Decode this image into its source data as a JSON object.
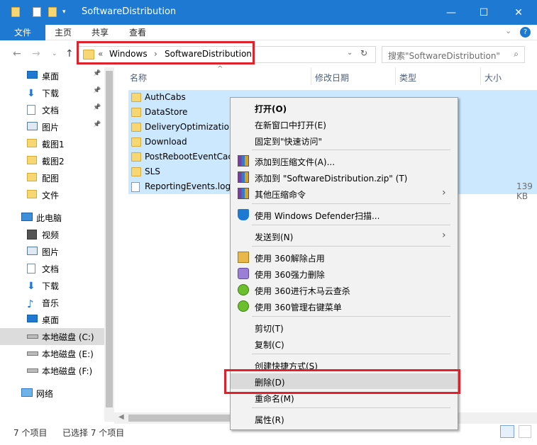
{
  "window": {
    "title": "SoftwareDistribution",
    "minimize": "—",
    "maximize": "☐",
    "close": "✕"
  },
  "ribbon": {
    "file": "文件",
    "tabs": [
      "主页",
      "共享",
      "查看"
    ]
  },
  "address": {
    "crumb_prefix": "«",
    "crumbs": [
      "Windows",
      "SoftwareDistribution"
    ],
    "search_placeholder": "搜索\"SoftwareDistribution\""
  },
  "sidebar": {
    "quick": [
      {
        "label": "桌面",
        "icon": "desktop-icon",
        "pinned": true
      },
      {
        "label": "下载",
        "icon": "download-icon",
        "pinned": true
      },
      {
        "label": "文档",
        "icon": "document-icon",
        "pinned": true
      },
      {
        "label": "图片",
        "icon": "picture-icon",
        "pinned": true
      },
      {
        "label": "截图1",
        "icon": "folder-icon",
        "pinned": false
      },
      {
        "label": "截图2",
        "icon": "folder-icon",
        "pinned": false
      },
      {
        "label": "配图",
        "icon": "folder-icon",
        "pinned": false
      },
      {
        "label": "文件",
        "icon": "folder-icon",
        "pinned": false
      }
    ],
    "pc": [
      {
        "label": "此电脑",
        "icon": "computer-icon"
      },
      {
        "label": "视频",
        "icon": "video-icon"
      },
      {
        "label": "图片",
        "icon": "picture-icon"
      },
      {
        "label": "文档",
        "icon": "document-icon"
      },
      {
        "label": "下载",
        "icon": "download-icon"
      },
      {
        "label": "音乐",
        "icon": "music-icon"
      },
      {
        "label": "桌面",
        "icon": "desktop-icon"
      },
      {
        "label": "本地磁盘 (C:)",
        "icon": "drive-icon"
      },
      {
        "label": "本地磁盘 (E:)",
        "icon": "drive-icon"
      },
      {
        "label": "本地磁盘 (F:)",
        "icon": "drive-icon"
      }
    ],
    "network": {
      "label": "网络",
      "icon": "network-icon"
    }
  },
  "columns": [
    "名称",
    "修改日期",
    "类型",
    "大小"
  ],
  "files": [
    {
      "name": "AuthCabs",
      "type": "folder",
      "size": ""
    },
    {
      "name": "DataStore",
      "type": "folder",
      "size": ""
    },
    {
      "name": "DeliveryOptimization",
      "type": "folder",
      "size": ""
    },
    {
      "name": "Download",
      "type": "folder",
      "size": ""
    },
    {
      "name": "PostRebootEventCac",
      "type": "folder",
      "size": ""
    },
    {
      "name": "SLS",
      "type": "folder",
      "size": ""
    },
    {
      "name": "ReportingEvents.log",
      "type": "file",
      "size": "139 KB"
    }
  ],
  "context_menu": [
    {
      "label": "打开(O)",
      "bold": true,
      "icon": ""
    },
    {
      "label": "在新窗口中打开(E)",
      "icon": ""
    },
    {
      "label": "固定到\"快速访问\"",
      "icon": ""
    },
    {
      "sep": true
    },
    {
      "label": "添加到压缩文件(A)...",
      "icon": "archive-icon"
    },
    {
      "label": "添加到 \"SoftwareDistribution.zip\" (T)",
      "icon": "archive-icon"
    },
    {
      "label": "其他压缩命令",
      "icon": "archive-icon",
      "submenu": true
    },
    {
      "sep": true
    },
    {
      "label": "使用 Windows Defender扫描...",
      "icon": "defender-shield-icon"
    },
    {
      "sep": true
    },
    {
      "label": "发送到(N)",
      "icon": "",
      "submenu": true
    },
    {
      "sep": true
    },
    {
      "label": "使用 360解除占用",
      "icon": "unlock-360-icon"
    },
    {
      "label": "使用 360强力删除",
      "icon": "shred-360-icon"
    },
    {
      "label": "使用 360进行木马云查杀",
      "icon": "scan-360-icon"
    },
    {
      "label": "使用 360管理右键菜单",
      "icon": "manage-360-icon"
    },
    {
      "sep": true
    },
    {
      "label": "剪切(T)",
      "icon": ""
    },
    {
      "label": "复制(C)",
      "icon": ""
    },
    {
      "sep": true
    },
    {
      "label": "创建快捷方式(S)",
      "icon": ""
    },
    {
      "label": "删除(D)",
      "icon": "",
      "highlighted": true
    },
    {
      "label": "重命名(M)",
      "icon": ""
    },
    {
      "sep": true
    },
    {
      "label": "属性(R)",
      "icon": ""
    }
  ],
  "status": {
    "count": "7 个项目",
    "selected": "已选择 7 个项目"
  },
  "colors": {
    "titlebar": "#1e79d3",
    "selection": "#cce8ff",
    "highlight_frame": "#e0202a"
  }
}
